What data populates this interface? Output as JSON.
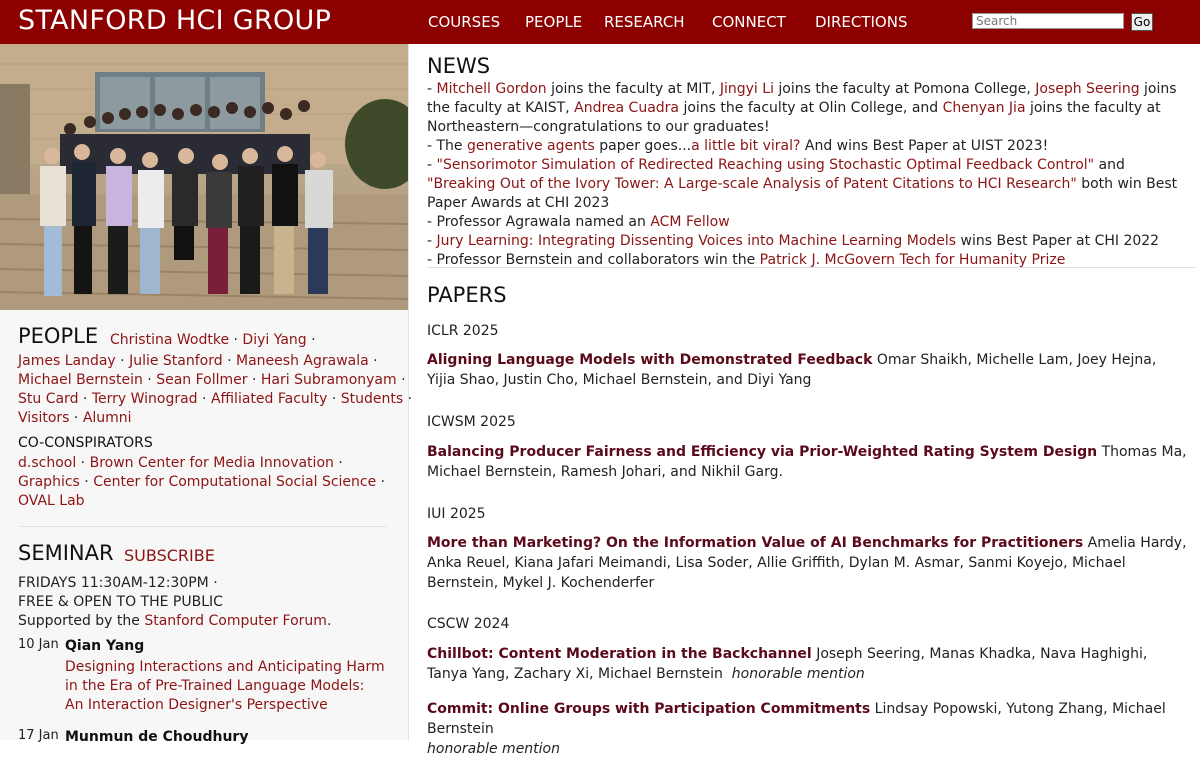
{
  "header": {
    "brand": "STANFORD HCI GROUP",
    "nav": [
      "COURSES",
      "PEOPLE",
      "RESEARCH",
      "CONNECT",
      "DIRECTIONS"
    ],
    "search_placeholder": "Search",
    "go_label": "Go"
  },
  "people": {
    "heading": "PEOPLE",
    "names": [
      "Christina Wodtke",
      "Diyi Yang",
      "James Landay",
      "Julie Stanford",
      "Maneesh Agrawala",
      "Michael Bernstein",
      "Sean Follmer",
      "Hari Subramonyam",
      "Stu Card",
      "Terry Winograd",
      "Affiliated Faculty",
      "Students",
      "Visitors",
      "Alumni"
    ],
    "coconspirators_heading": "CO-CONSPIRATORS",
    "coconspirators": [
      "d.school",
      "Brown Center for Media Innovation",
      "Graphics",
      "Center for Computational Social Science",
      "OVAL Lab"
    ]
  },
  "seminar": {
    "heading": "SEMINAR",
    "subscribe": "SUBSCRIBE",
    "time": "FRIDAYS 11:30AM-12:30PM ·",
    "free": "FREE & OPEN TO THE PUBLIC",
    "supported_prefix": "Supported by the ",
    "supported_link": "Stanford Computer Forum",
    "supported_suffix": ".",
    "talks": [
      {
        "date": "10 Jan",
        "speaker": "Qian Yang",
        "title": "Designing Interactions and Anticipating Harm in the Era of Pre-Trained Language Models: An Interaction Designer's Perspective"
      },
      {
        "date": "17 Jan",
        "speaker": "Munmun de Choudhury",
        "title": ""
      }
    ]
  },
  "news": {
    "heading": "NEWS",
    "items": [
      {
        "parts": [
          [
            "- ",
            false
          ],
          [
            "Mitchell Gordon",
            true
          ],
          [
            " joins the faculty at MIT, ",
            false
          ],
          [
            "Jingyi Li",
            true
          ],
          [
            " joins the faculty at Pomona College, ",
            false
          ],
          [
            "Joseph Seering",
            true
          ],
          [
            " joins the faculty at KAIST, ",
            false
          ],
          [
            "Andrea Cuadra",
            true
          ],
          [
            " joins the faculty at Olin College, and ",
            false
          ],
          [
            "Chenyan Jia",
            true
          ],
          [
            " joins the faculty at Northeastern—congratulations to our graduates!",
            false
          ]
        ]
      },
      {
        "parts": [
          [
            "- The ",
            false
          ],
          [
            "generative agents",
            true
          ],
          [
            " paper goes...",
            false
          ],
          [
            "a little bit viral?",
            true
          ],
          [
            " And wins Best Paper at UIST 2023!",
            false
          ]
        ]
      },
      {
        "parts": [
          [
            "- ",
            false
          ],
          [
            "\"Sensorimotor Simulation of Redirected Reaching using Stochastic Optimal Feedback Control\"",
            true
          ],
          [
            " and ",
            false
          ],
          [
            "\"Breaking Out of the Ivory Tower: A Large-scale Analysis of Patent Citations to HCI Research\"",
            true
          ],
          [
            " both win Best Paper Awards at CHI 2023",
            false
          ]
        ]
      },
      {
        "parts": [
          [
            "- Professor Agrawala named an ",
            false
          ],
          [
            "ACM Fellow",
            true
          ]
        ]
      },
      {
        "parts": [
          [
            "- ",
            false
          ],
          [
            "Jury Learning: Integrating Dissenting Voices into Machine Learning Models",
            true
          ],
          [
            " wins Best Paper at CHI 2022",
            false
          ]
        ]
      },
      {
        "parts": [
          [
            "- Professor Bernstein and collaborators win the ",
            false
          ],
          [
            "Patrick J. McGovern Tech for Humanity Prize",
            true
          ]
        ]
      }
    ]
  },
  "papers": {
    "heading": "PAPERS",
    "groups": [
      {
        "venue": "ICLR 2025",
        "title": "Aligning Language Models with Demonstrated Feedback",
        "authors": "Omar Shaikh, Michelle Lam, Joey Hejna, Yijia Shao, Justin Cho, Michael Bernstein, and Diyi Yang",
        "note": ""
      },
      {
        "venue": "ICWSM 2025",
        "title": "Balancing Producer Fairness and Efficiency via Prior-Weighted Rating System Design",
        "authors": "Thomas Ma, Michael Bernstein, Ramesh Johari, and Nikhil Garg.",
        "note": ""
      },
      {
        "venue": "IUI 2025",
        "title": "More than Marketing? On the Information Value of AI Benchmarks for Practitioners",
        "authors": "Amelia Hardy, Anka Reuel, Kiana Jafari Meimandi, Lisa Soder, Allie Griffith, Dylan M. Asmar, Sanmi Koyejo, Michael Bernstein, Mykel J. Kochenderfer",
        "note": ""
      },
      {
        "venue": "CSCW 2024",
        "title": "Chillbot: Content Moderation in the Backchannel",
        "authors": "Joseph Seering, Manas Khadka, Nava Haghighi, Tanya Yang, Zachary Xi, Michael Bernstein",
        "note": "honorable mention"
      },
      {
        "venue": "",
        "title": "Commit: Online Groups with Participation Commitments",
        "authors": "Lindsay Popowski, Yutong Zhang, Michael Bernstein",
        "note": "honorable mention"
      }
    ]
  },
  "colors": {
    "header_bg": "#8c0000",
    "link": "#8c1515",
    "paper_title": "#5a0a1a"
  }
}
